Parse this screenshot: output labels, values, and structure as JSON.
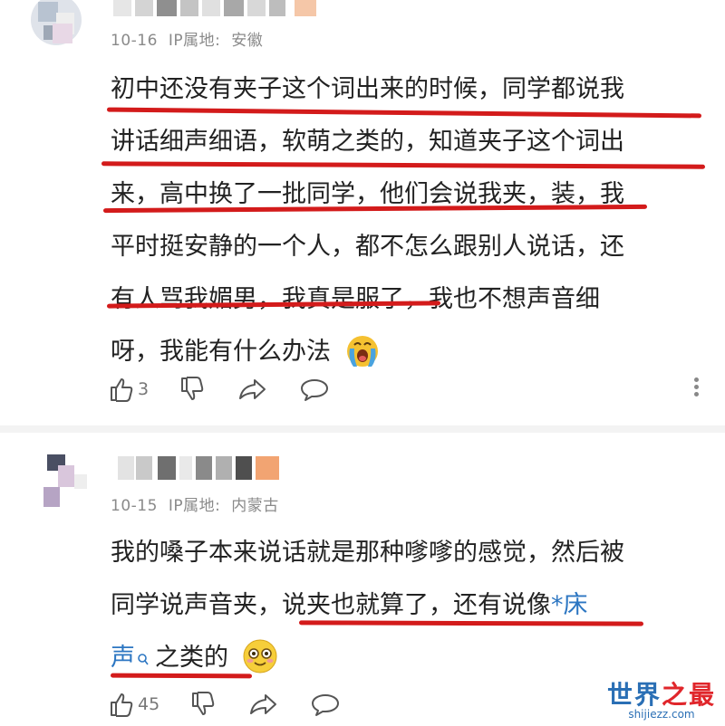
{
  "comments": [
    {
      "date": "10-16",
      "ip_label": "IP属地:",
      "location": "安徽",
      "lines": [
        "初中还没有夹子这个词出来的时候，同学都说我",
        "讲话细声细语，软萌之类的，知道夹子这个词出",
        "来，高中换了一批同学，他们会说我夹，装，我",
        "平时挺安静的一个人，都不怎么跟别人说话，还",
        "有人骂我媚男，我真是服了，我也不想声音细",
        "呀，我能有什么办法"
      ],
      "emoji_icon": "crying-face-icon",
      "likes": "3"
    },
    {
      "date": "10-15",
      "ip_label": "IP属地:",
      "location": "内蒙古",
      "line1": "我的嗓子本来说话就是那种嗲嗲的感觉，然后被",
      "line2_plain": "同学说声音夹，说夹也就算了，还有说像",
      "line2_link": "*床",
      "line3_link": "声",
      "line3_plain": "之类的",
      "emoji_icon": "smiling-face-icon",
      "likes": "45"
    }
  ],
  "watermark": {
    "title_part1": "世界",
    "title_part2": "之最",
    "url": "shijiezz.com"
  },
  "colors": {
    "underline": "#d31b1b",
    "link": "#2c76c2",
    "meta": "#8a8a8a"
  }
}
